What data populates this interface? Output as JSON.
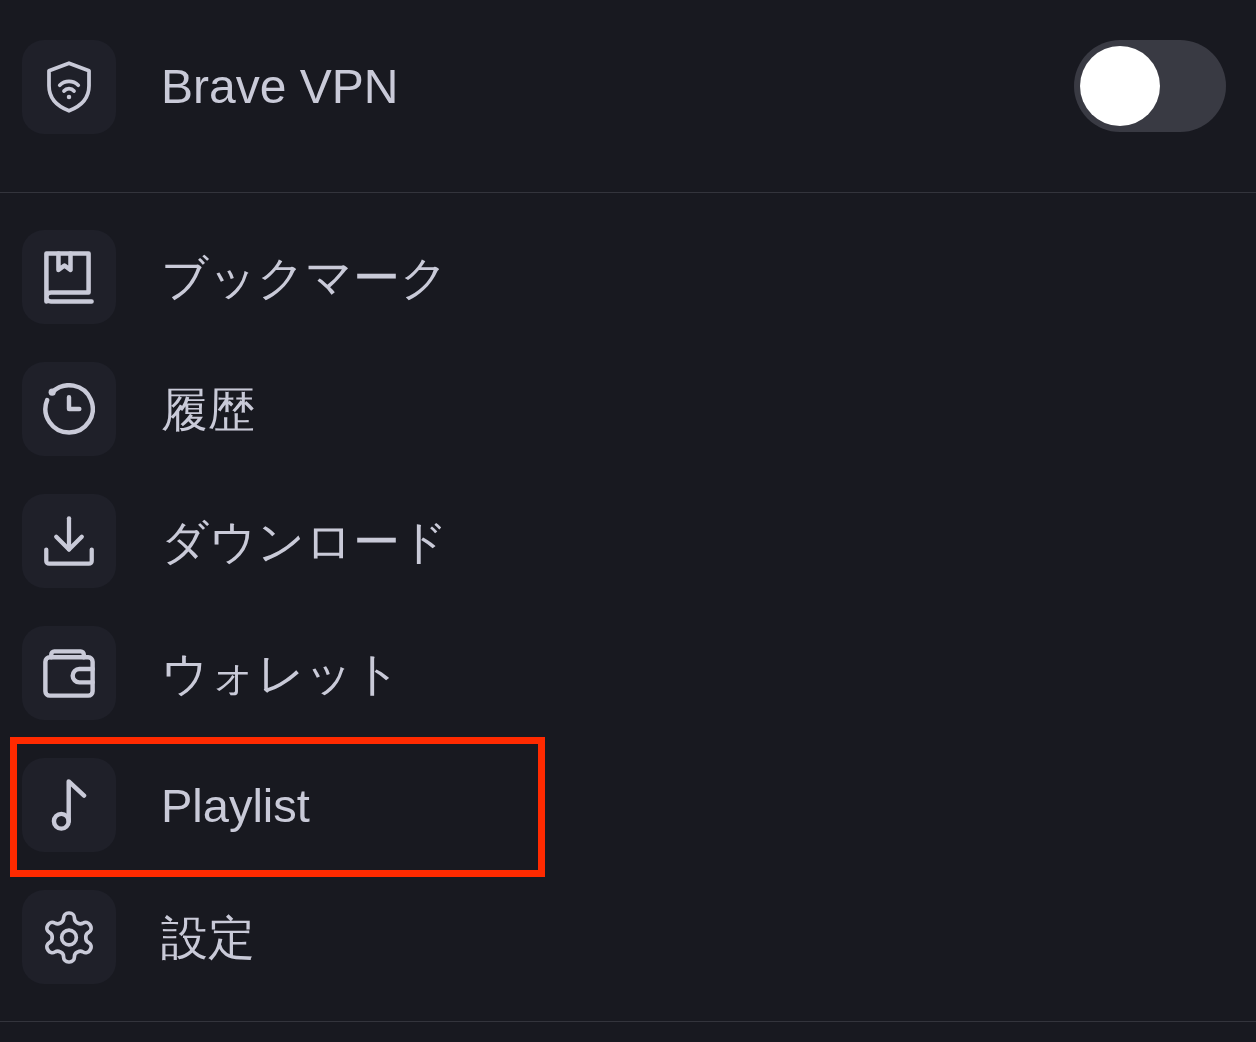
{
  "vpn": {
    "label": "Brave VPN",
    "on": false
  },
  "items": [
    {
      "label": "ブックマーク",
      "highlighted": false
    },
    {
      "label": "履歴",
      "highlighted": false
    },
    {
      "label": "ダウンロード",
      "highlighted": false
    },
    {
      "label": "ウォレット",
      "highlighted": false
    },
    {
      "label": "Playlist",
      "highlighted": true
    },
    {
      "label": "設定",
      "highlighted": false
    }
  ]
}
